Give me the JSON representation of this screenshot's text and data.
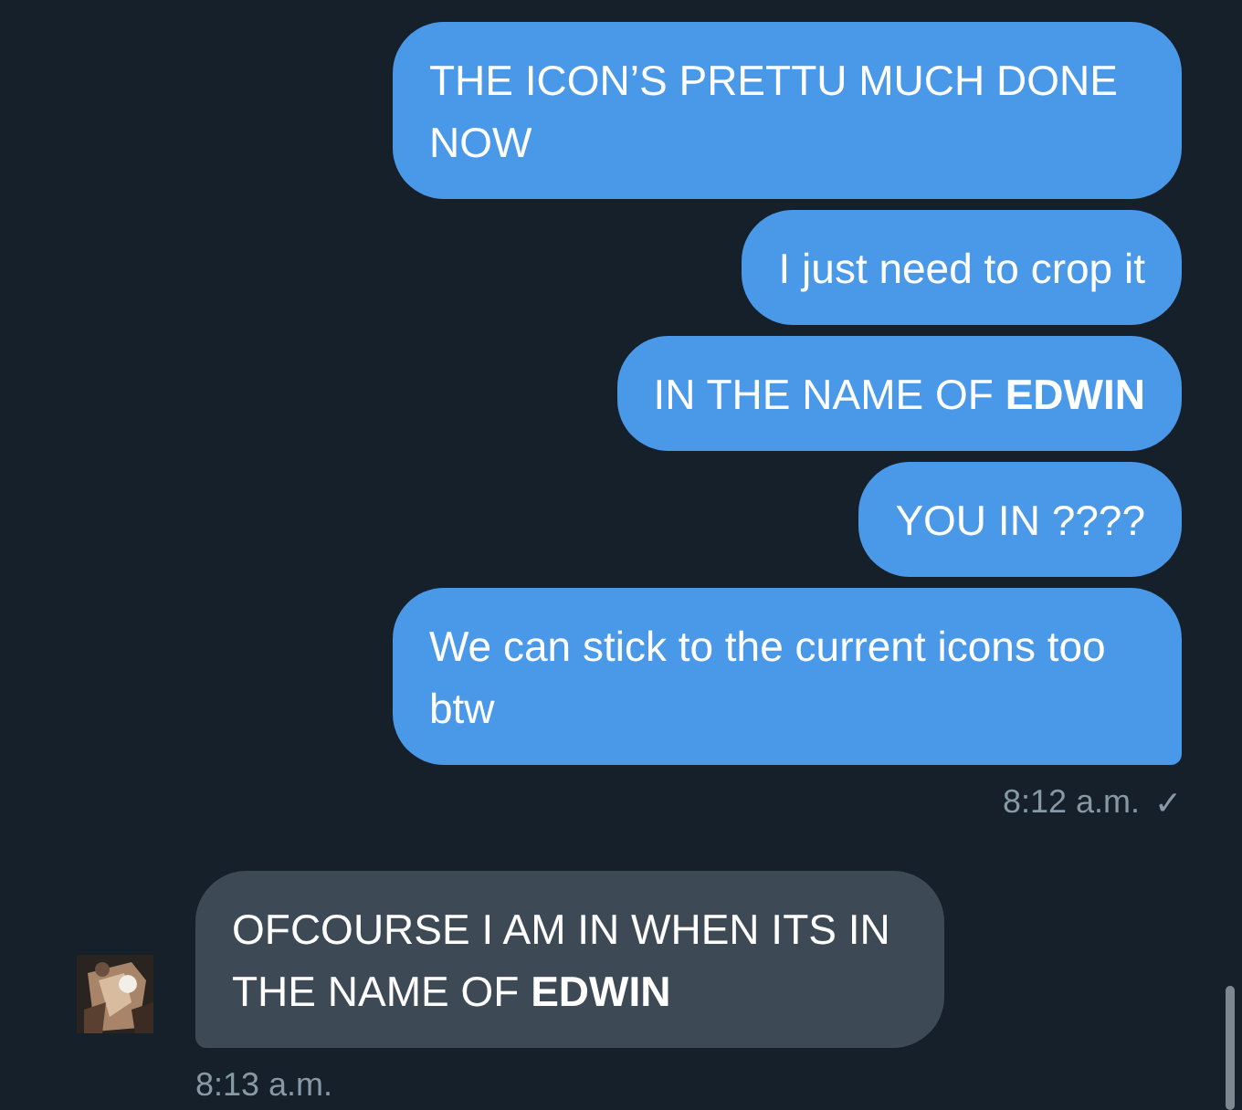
{
  "conversation": [
    {
      "kind": "sent",
      "messages": [
        "THE ICON’S PRETTU MUCH DONE NOW",
        "I just need to crop it",
        "IN THE NAME OF **EDWIN**",
        "YOU IN ????",
        "We can stick to the current icons too btw"
      ],
      "time": "8:12 a.m.",
      "receipt": "✓"
    },
    {
      "kind": "received",
      "avatar": {
        "kind": "picture"
      },
      "messages": [
        "OFCOURSE I AM IN WHEN ITS IN THE NAME OF **EDWIN**"
      ],
      "time": "8:13 a.m."
    }
  ]
}
